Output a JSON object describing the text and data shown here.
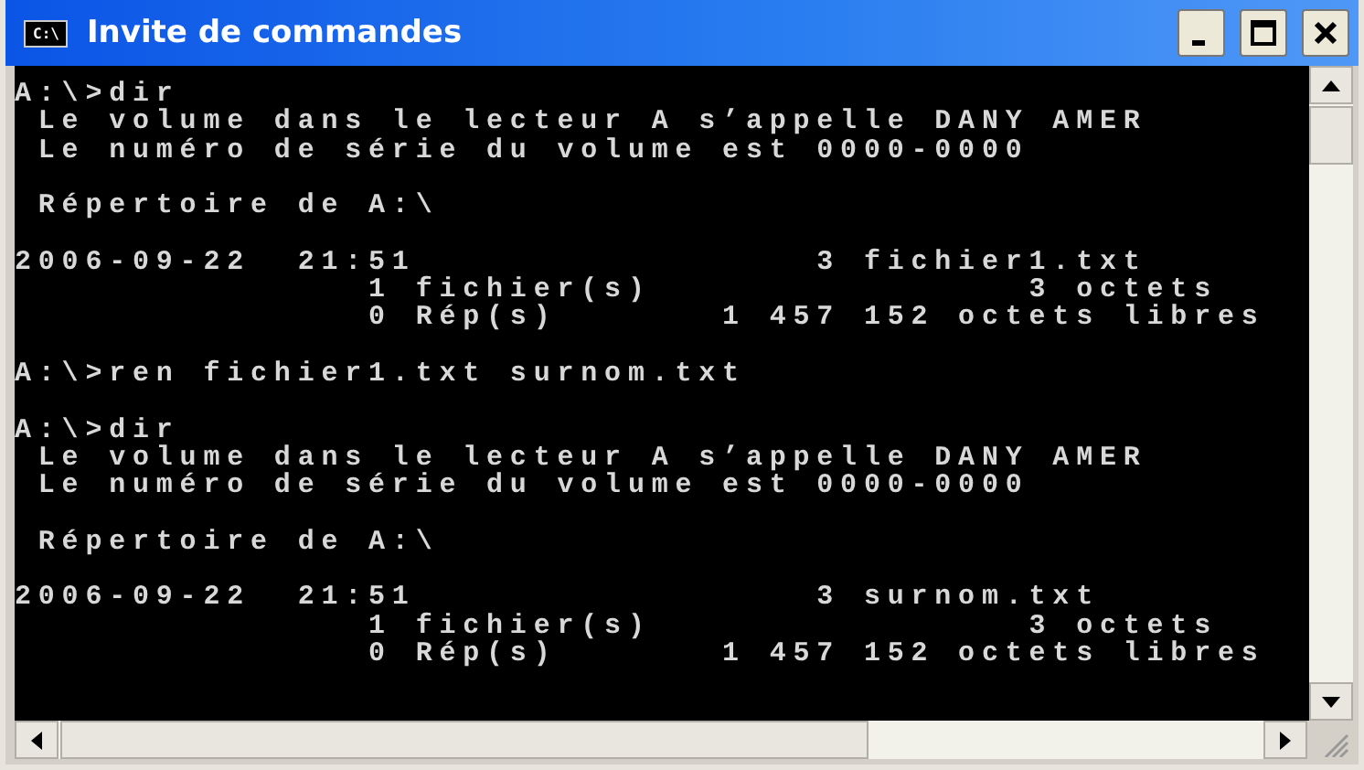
{
  "window": {
    "title": "Invite de commandes",
    "icon_text": "C:\\"
  },
  "console": {
    "lines": [
      {
        "text": "A:\\>dir",
        "space_before": false
      },
      {
        "text": " Le volume dans le lecteur A s’appelle DANY AMER",
        "space_before": false
      },
      {
        "text": " Le numéro de série du volume est 0000-0000",
        "space_before": false
      },
      {
        "text": " Répertoire de A:\\",
        "space_before": true
      },
      {
        "text": "2006-09-22  21:51                 3 fichier1.txt",
        "space_before": true
      },
      {
        "text": "               1 fichier(s)                3 octets",
        "space_before": false
      },
      {
        "text": "               0 Rép(s)       1 457 152 octets libres",
        "space_before": false
      },
      {
        "text": "A:\\>ren fichier1.txt surnom.txt",
        "space_before": true
      },
      {
        "text": "A:\\>dir",
        "space_before": true
      },
      {
        "text": " Le volume dans le lecteur A s’appelle DANY AMER",
        "space_before": false
      },
      {
        "text": " Le numéro de série du volume est 0000-0000",
        "space_before": false
      },
      {
        "text": " Répertoire de A:\\",
        "space_before": true
      },
      {
        "text": "2006-09-22  21:51                 3 surnom.txt",
        "space_before": true
      },
      {
        "text": "               1 fichier(s)                3 octets",
        "space_before": false
      },
      {
        "text": "               0 Rép(s)       1 457 152 octets libres",
        "space_before": false
      }
    ]
  }
}
